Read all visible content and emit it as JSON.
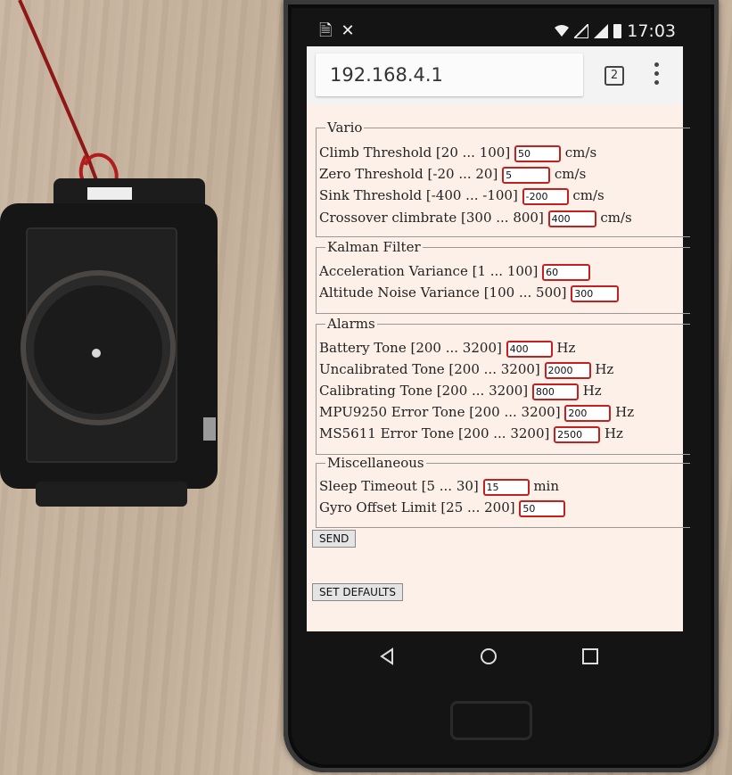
{
  "status": {
    "time": "17:03"
  },
  "browser": {
    "url": "192.168.4.1",
    "tab_count": "2"
  },
  "form": {
    "vario": {
      "legend": "Vario",
      "rows": [
        {
          "label": "Climb Threshold [20 ... 100]",
          "value": "50",
          "unit": "cm/s"
        },
        {
          "label": "Zero Threshold [-20 ... 20]",
          "value": "5",
          "unit": "cm/s"
        },
        {
          "label": "Sink Threshold [-400 ... -100]",
          "value": "-200",
          "unit": "cm/s"
        },
        {
          "label": "Crossover climbrate [300 ... 800]",
          "value": "400",
          "unit": "cm/s"
        }
      ]
    },
    "kalman": {
      "legend": "Kalman Filter",
      "rows": [
        {
          "label": "Acceleration Variance [1 ... 100]",
          "value": "60",
          "unit": ""
        },
        {
          "label": "Altitude Noise Variance [100 ... 500]",
          "value": "300",
          "unit": ""
        }
      ]
    },
    "alarms": {
      "legend": "Alarms",
      "rows": [
        {
          "label": "Battery Tone [200 ... 3200]",
          "value": "400",
          "unit": "Hz"
        },
        {
          "label": "Uncalibrated Tone [200 ... 3200]",
          "value": "2000",
          "unit": "Hz"
        },
        {
          "label": "Calibrating Tone [200 ... 3200]",
          "value": "800",
          "unit": "Hz"
        },
        {
          "label": "MPU9250 Error Tone [200 ... 3200]",
          "value": "200",
          "unit": "Hz"
        },
        {
          "label": "MS5611 Error Tone [200 ... 3200]",
          "value": "2500",
          "unit": "Hz"
        }
      ]
    },
    "misc": {
      "legend": "Miscellaneous",
      "rows": [
        {
          "label": "Sleep Timeout [5 ... 30]",
          "value": "15",
          "unit": "min"
        },
        {
          "label": "Gyro Offset Limit [25 ... 200]",
          "value": "50",
          "unit": ""
        }
      ]
    },
    "send_label": "SEND",
    "defaults_label": "SET DEFAULTS"
  }
}
